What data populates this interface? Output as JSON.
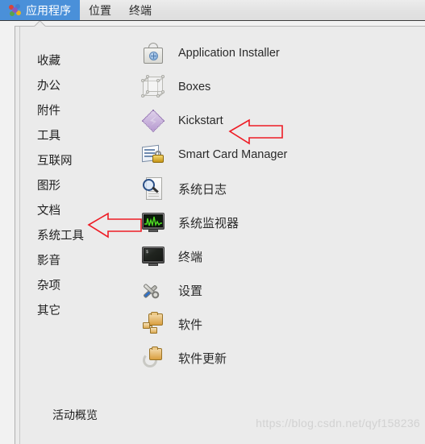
{
  "menubar": {
    "items": [
      {
        "label": "应用程序",
        "icon": "applications-logo-icon",
        "active": true
      },
      {
        "label": "位置",
        "icon": null,
        "active": false
      },
      {
        "label": "终端",
        "icon": null,
        "active": false
      }
    ]
  },
  "categories": [
    {
      "label": "收藏"
    },
    {
      "label": "办公"
    },
    {
      "label": "附件"
    },
    {
      "label": "工具"
    },
    {
      "label": "互联网"
    },
    {
      "label": "图形"
    },
    {
      "label": "文档"
    },
    {
      "label": "系统工具"
    },
    {
      "label": "影音"
    },
    {
      "label": "杂项"
    },
    {
      "label": "其它"
    }
  ],
  "applications": [
    {
      "label": "Application Installer",
      "icon": "app-installer-bag-icon",
      "cjk": false
    },
    {
      "label": "Boxes",
      "icon": "boxes-wireframe-cube-icon",
      "cjk": false
    },
    {
      "label": "Kickstart",
      "icon": "kickstart-diamond-icon",
      "cjk": false
    },
    {
      "label": "Smart Card Manager",
      "icon": "smart-card-lock-icon",
      "cjk": false
    },
    {
      "label": "系统日志",
      "icon": "system-log-magnifier-icon",
      "cjk": true
    },
    {
      "label": "系统监视器",
      "icon": "system-monitor-icon",
      "cjk": true
    },
    {
      "label": "终端",
      "icon": "terminal-icon",
      "cjk": true
    },
    {
      "label": "设置",
      "icon": "settings-tools-icon",
      "cjk": true
    },
    {
      "label": "软件",
      "icon": "software-package-icon",
      "cjk": true
    },
    {
      "label": "软件更新",
      "icon": "software-update-icon",
      "cjk": true
    }
  ],
  "footer": {
    "overview_label": "活动概览",
    "watermark": "https://blog.csdn.net/qyf158236"
  },
  "annotations": [
    {
      "name": "kickstart",
      "target": "Kickstart",
      "shape": "left-arrow",
      "color": "#ee1c25"
    },
    {
      "name": "system-tools",
      "target": "系统工具",
      "shape": "left-arrow",
      "color": "#ee1c25"
    }
  ],
  "terminal_icon_prompt": "$",
  "colors": {
    "menubar_active": "#4a90d9",
    "panel_background": "#ebebeb",
    "topbar_background": "#e2e2e2",
    "annotation_red": "#ee1c25",
    "watermark_grey": "#d2d2d2"
  }
}
